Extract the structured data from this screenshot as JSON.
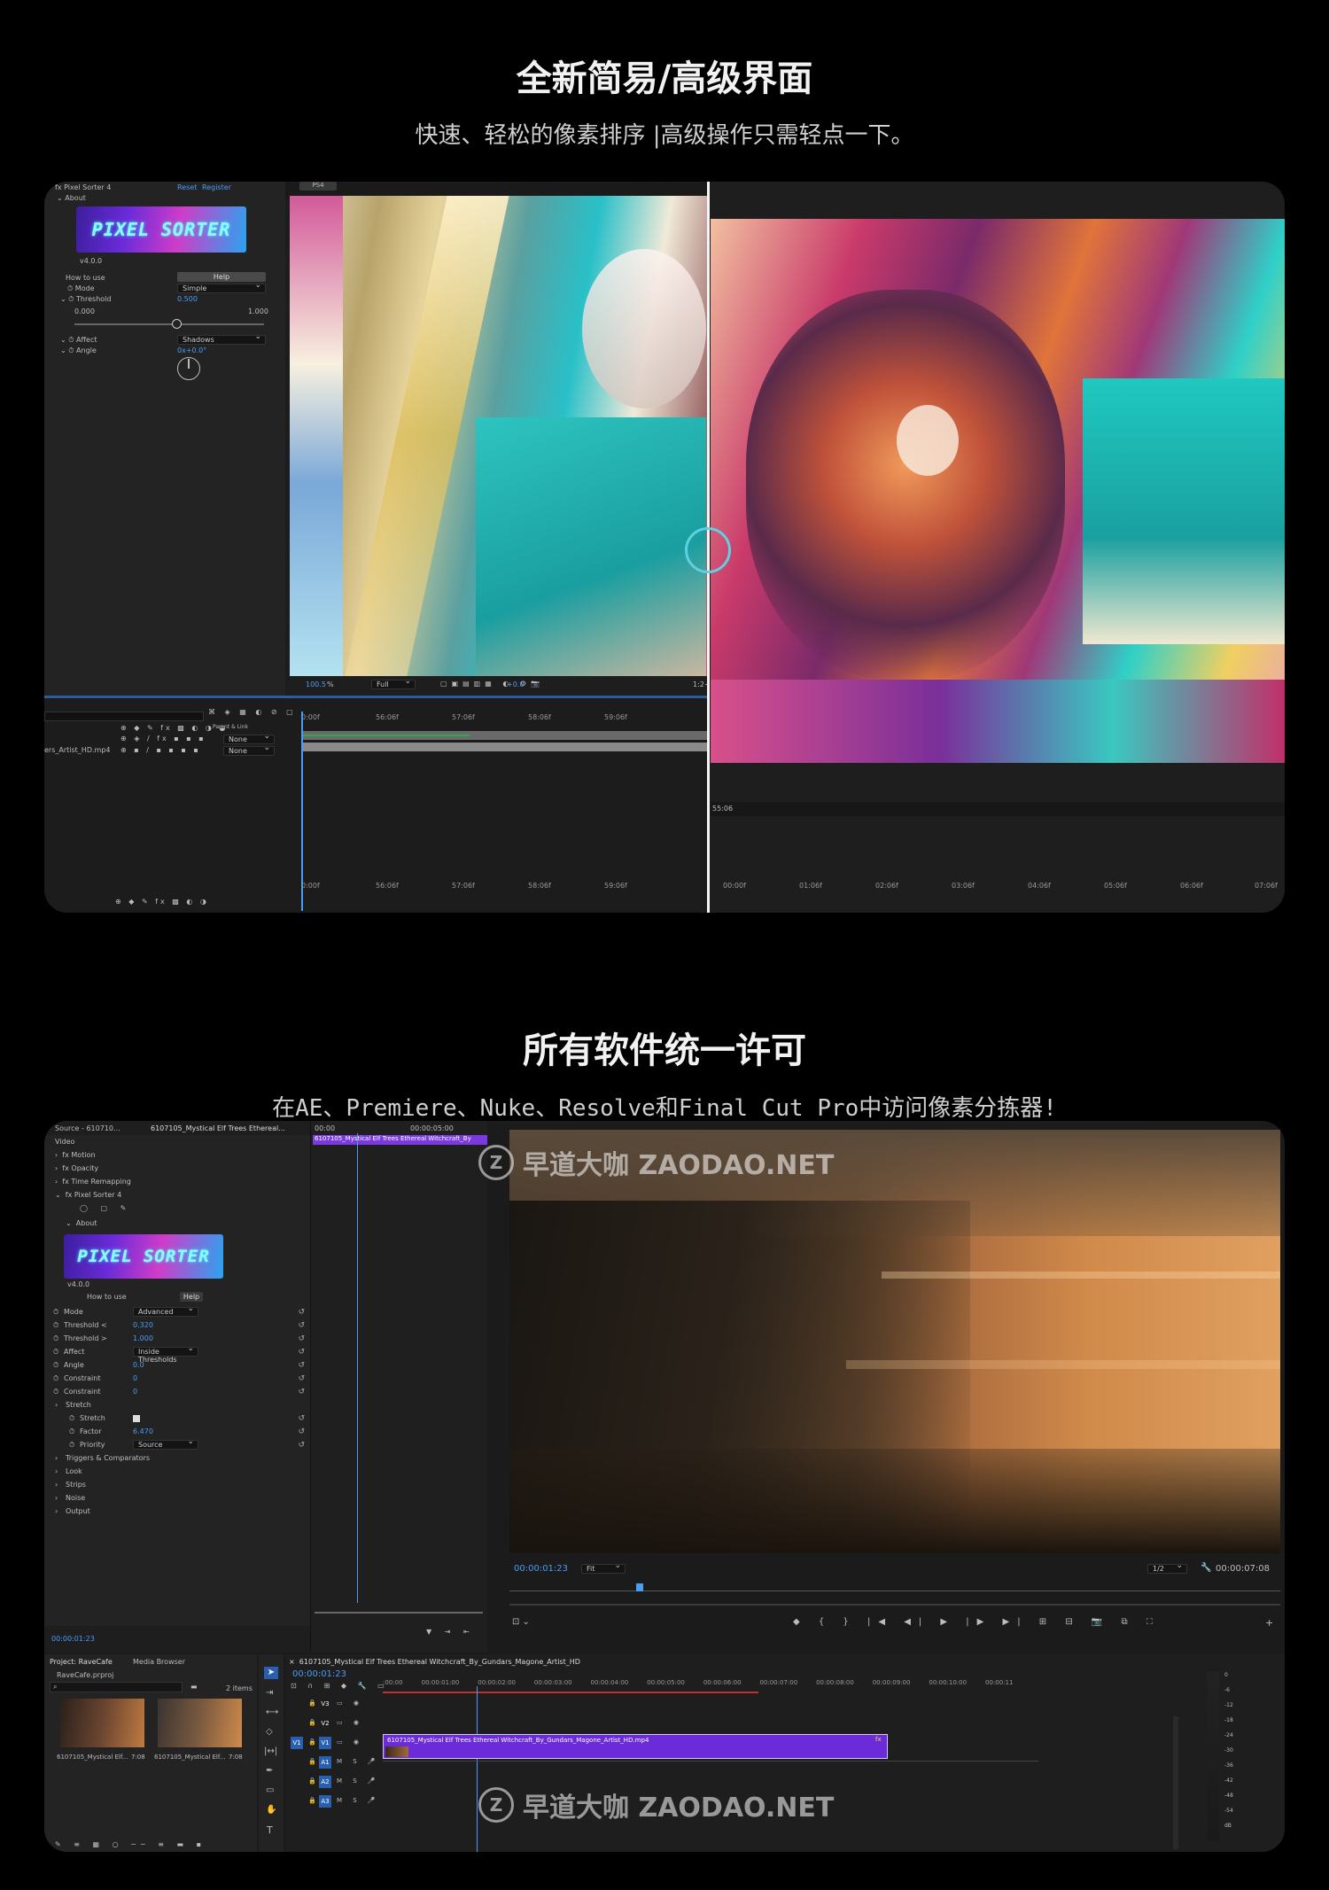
{
  "section1": {
    "title": "全新简易/高级界面",
    "subtitle": "快速、轻松的像素排序 |高级操作只需轻点一下。"
  },
  "section2": {
    "title": "所有软件统一许可",
    "subtitle": "在AE、Premiere、Nuke、Resolve和Final Cut Pro中访问像素分拣器!"
  },
  "ae": {
    "effect_name": "Pixel Sorter 4",
    "reset": "Reset",
    "register": "Register",
    "about": "About",
    "logo": "PIXEL SORTER",
    "version": "v4.0.0",
    "how_to_use": "How to use",
    "help": "Help",
    "mode_label": "Mode",
    "mode_value": "Simple",
    "threshold_label": "Threshold",
    "threshold_value": "0.500",
    "slider_min": "0.000",
    "slider_max": "1.000",
    "affect_label": "Affect",
    "affect_value": "Shadows",
    "angle_label": "Angle",
    "angle_value": "0x+0.0°",
    "tab": "PS4",
    "zoom": "100.5",
    "zoom_unit": "%",
    "resolution": "Full",
    "exposure": "+0.0",
    "ruler": [
      "0:00f",
      "56:06f",
      "57:06f",
      "58:06f",
      "59:06f"
    ],
    "ruler_right": [
      "00:00f",
      "01:06f",
      "02:06f",
      "03:06f",
      "04:06f",
      "05:06f",
      "06:06f",
      "07:06f"
    ],
    "parent_link": "Parent & Link",
    "none1": "None",
    "none2": "None",
    "layer_name": "ers_Artist_HD.mp4",
    "timecode_right": "55:06",
    "right_value": "1:2+"
  },
  "pr": {
    "source_tab": "Source - 610710...",
    "effect_tab": "6107105_Mystical Elf Trees Ethereal...",
    "time_start": "00:00",
    "time_end": "00:00:05:00",
    "clip_label": "6107105_Mystical Elf Trees Ethereal Witchcraft_By",
    "video": "Video",
    "motion": "Motion",
    "opacity": "Opacity",
    "time_remap": "Time Remapping",
    "effect_name": "Pixel Sorter 4",
    "about": "About",
    "logo": "PIXEL SORTER",
    "version": "v4.0.0",
    "how_to_use": "How to use",
    "help": "Help",
    "props": [
      {
        "label": "Mode",
        "value": "Advanced",
        "type": "dd"
      },
      {
        "label": "Threshold <",
        "value": "0.320",
        "type": "num"
      },
      {
        "label": "Threshold >",
        "value": "1.000",
        "type": "num"
      },
      {
        "label": "Affect",
        "value": "Inside Thresholds",
        "type": "dd"
      },
      {
        "label": "Angle",
        "value": "0.0",
        "type": "num"
      },
      {
        "label": "Constraint",
        "value": "0",
        "type": "num"
      },
      {
        "label": "Constraint",
        "value": "0",
        "type": "num"
      },
      {
        "label": "Stretch",
        "value": "",
        "type": "group"
      },
      {
        "label": "Stretch",
        "value": "",
        "type": "check"
      },
      {
        "label": "Factor",
        "value": "6.470",
        "type": "num"
      },
      {
        "label": "Priority",
        "value": "Source",
        "type": "dd"
      },
      {
        "label": "Triggers & Comparators",
        "value": "",
        "type": "group"
      },
      {
        "label": "Look",
        "value": "",
        "type": "group"
      },
      {
        "label": "Strips",
        "value": "",
        "type": "group"
      },
      {
        "label": "Noise",
        "value": "",
        "type": "group"
      },
      {
        "label": "Output",
        "value": "",
        "type": "group"
      }
    ],
    "ec_timecode": "00:00:01:23",
    "program_timecode": "00:00:01:23",
    "fit": "Fit",
    "quality": "1/2",
    "duration": "00:00:07:08",
    "project_tab": "Project: RaveCafe",
    "media_browser": "Media Browser",
    "project_file": "RaveCafe.prproj",
    "items": "2 items",
    "thumb1": "6107105_Mystical Elf...",
    "thumb1_dur": "7:08",
    "thumb2": "6107105_Mystical Elf...",
    "thumb2_dur": "7:08",
    "seq_tab": "6107105_Mystical Elf Trees Ethereal Witchcraft_By_Gundars_Magone_Artist_HD",
    "seq_timecode": "00:00:01:23",
    "seq_ruler": [
      ":00:00",
      "00:00:01:00",
      "00:00:02:00",
      "00:00:03:00",
      "00:00:04:00",
      "00:00:05:00",
      "00:00:06:00",
      "00:00:07:00",
      "00:00:08:00",
      "00:00:09:00",
      "00:00:10:00",
      "00:00:11"
    ],
    "clip_name": "6107105_Mystical Elf Trees Ethereal Witchcraft_By_Gundars_Magone_Artist_HD.mp4",
    "tracks": [
      "V3",
      "V2",
      "V1",
      "A1",
      "A2",
      "A3"
    ],
    "meter": [
      "0",
      "-6",
      "-12",
      "-18",
      "-24",
      "-30",
      "-36",
      "-42",
      "-48",
      "-54",
      "dB"
    ]
  },
  "watermark": {
    "text": "早道大咖 ZAODAO.NET",
    "mark": "Z"
  },
  "colors": {
    "background": "#000000",
    "panel": "#1d1d1d",
    "accent_blue": "#4a9cf5",
    "clip_purple": "#6b2bd9"
  }
}
